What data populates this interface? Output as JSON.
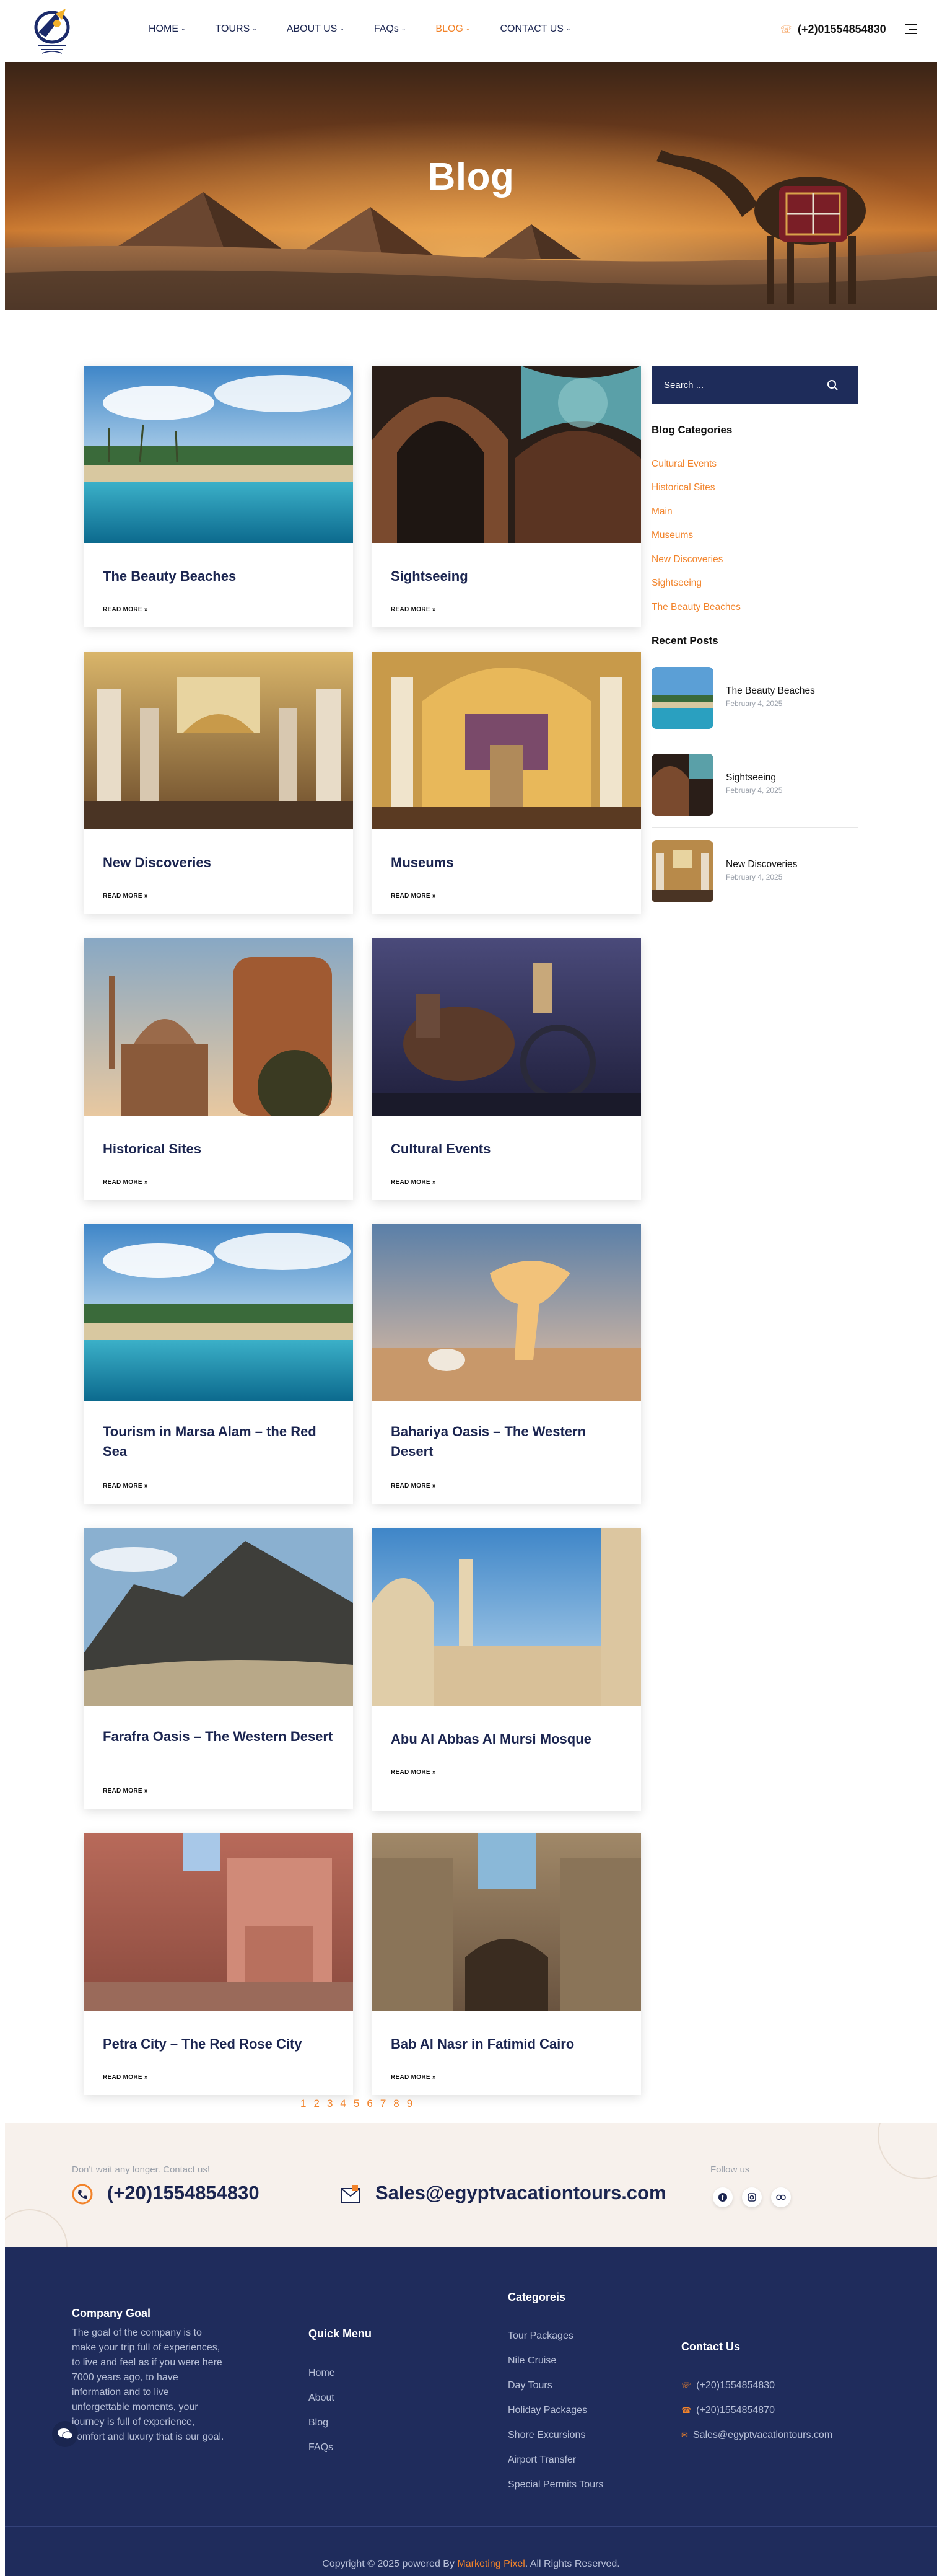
{
  "header": {
    "logo_alt": "Egypt Vacation Tours",
    "nav": [
      {
        "label": "HOME",
        "caret": "⌄",
        "active": false
      },
      {
        "label": "TOURS",
        "caret": "⌄",
        "active": false
      },
      {
        "label": "ABOUT US",
        "caret": "⌄",
        "active": false
      },
      {
        "label": "FAQs",
        "caret": "⌄",
        "active": false
      },
      {
        "label": "BLOG",
        "caret": "⌄",
        "active": true
      },
      {
        "label": "CONTACT US",
        "caret": "⌄",
        "active": false
      }
    ],
    "phone": "(+2)01554854830",
    "phone_icon": "phone-icon",
    "menu_icon": "hamburger-icon"
  },
  "hero": {
    "title": "Blog"
  },
  "posts": [
    {
      "title": "The Beauty Beaches",
      "more": "READ MORE »",
      "image": "beach"
    },
    {
      "title": "Sightseeing",
      "more": "READ MORE »",
      "image": "mosque-interior"
    },
    {
      "title": "New Discoveries",
      "more": "READ MORE »",
      "image": "museum-hall"
    },
    {
      "title": "Museums",
      "more": "READ MORE »",
      "image": "museum-statue"
    },
    {
      "title": "Historical Sites",
      "more": "READ MORE »",
      "image": "citadel"
    },
    {
      "title": "Cultural Events",
      "more": "READ MORE »",
      "image": "chariot"
    },
    {
      "title": "Tourism in Marsa Alam – the Red Sea",
      "more": "READ MORE »",
      "image": "beach"
    },
    {
      "title": "Bahariya Oasis – The Western Desert",
      "more": "READ MORE »",
      "image": "white-desert"
    },
    {
      "title": "Farafra Oasis – The Western Desert",
      "more": "READ MORE »",
      "image": "black-desert"
    },
    {
      "title": "Abu Al Abbas Al Mursi Mosque",
      "more": "READ MORE »",
      "image": "mosque-exterior"
    },
    {
      "title": "Petra City – The Red Rose City",
      "more": "READ MORE »",
      "image": "petra"
    },
    {
      "title": "Bab Al Nasr in Fatimid Cairo",
      "more": "READ MORE »",
      "image": "gate"
    }
  ],
  "sidebar": {
    "search_placeholder": "Search ...",
    "search_icon": "search-icon",
    "categories_heading": "Blog Categories",
    "categories": [
      "Cultural Events",
      "Historical Sites",
      "Main",
      "Museums",
      "New Discoveries",
      "Sightseeing",
      "The Beauty Beaches"
    ],
    "recent_heading": "Recent Posts",
    "recent": [
      {
        "title": "The Beauty Beaches",
        "date": "February 4, 2025",
        "image": "beach"
      },
      {
        "title": "Sightseeing",
        "date": "February 4, 2025",
        "image": "mosque-interior"
      },
      {
        "title": "New Discoveries",
        "date": "February 4, 2025",
        "image": "museum-hall"
      }
    ]
  },
  "pagination": [
    "1",
    "2",
    "3",
    "4",
    "5",
    "6",
    "7",
    "8",
    "9"
  ],
  "contact_band": {
    "tagline": "Don't wait any longer. Contact us!",
    "phone": "(+20)1554854830",
    "email": "Sales@egyptvacationtours.com",
    "follow_label": "Follow us",
    "socials": [
      "facebook-icon",
      "instagram-icon",
      "tripadvisor-icon"
    ]
  },
  "footer": {
    "company_heading": "Company Goal",
    "company_text": "The goal of the company is to make your trip full of experiences, to live and feel as if you were here 7000 years ago, to have information and to live unforgettable moments, your journey is full of experience, comfort and luxury that is our goal.",
    "quick_heading": "Quick Menu",
    "quick_links": [
      "Home",
      "About",
      "Blog",
      "FAQs"
    ],
    "categories_heading": "Categoreis",
    "categories": [
      "Tour Packages",
      "Nile Cruise",
      "Day Tours",
      "Holiday Packages",
      "Shore Excursions",
      "Airport Transfer",
      "Special Permits Tours"
    ],
    "contact_heading": "Contact Us",
    "contacts": [
      "(+20)1554854830",
      "(+20)1554854870",
      "Sales@egyptvacationtours.com"
    ],
    "copyright_prefix": "Copyright © 2025 powered By",
    "copyright_brand": "Marketing Pixel",
    "copyright_suffix": ". All Rights Reserved."
  },
  "colors": {
    "accent": "#f2832a",
    "navy": "#1b2550",
    "footer_bg": "#1f2c5c"
  }
}
